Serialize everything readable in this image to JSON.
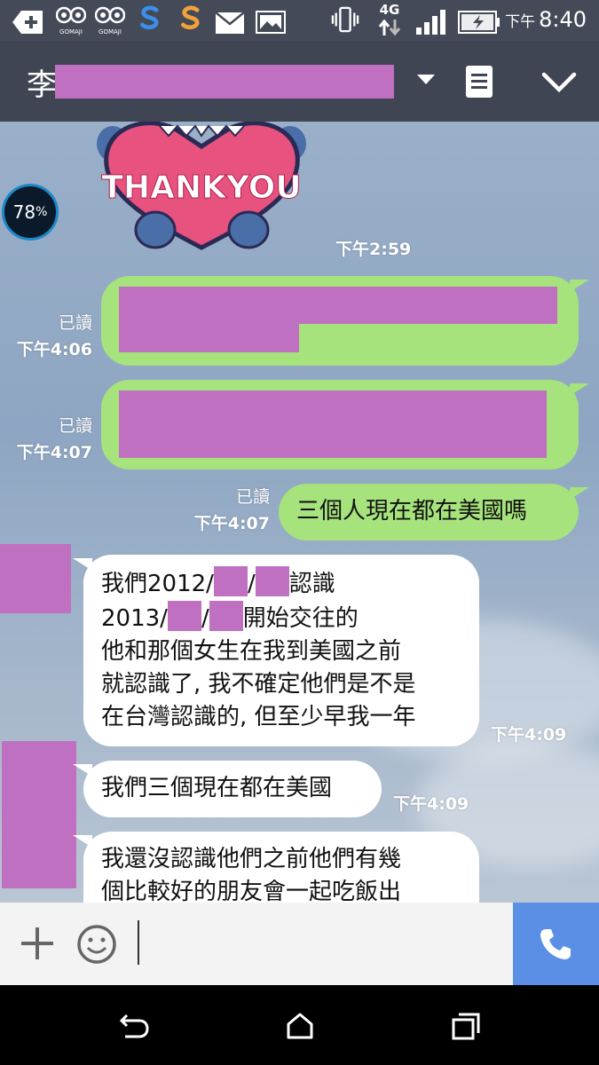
{
  "status_bar": {
    "ampm": "下午",
    "time": "8:40",
    "network": "4G",
    "app_icons": [
      "add-icon",
      "gomaji-icon",
      "gomaji-icon",
      "s-app-icon",
      "s-app-icon",
      "mail-icon",
      "image-icon"
    ],
    "app_labels": [
      "GOMAJI",
      "GOMAJI"
    ]
  },
  "header": {
    "contact_initial": "李"
  },
  "sticker": {
    "text": "THANKYOU",
    "time": "下午2:59"
  },
  "floating_badge": {
    "value": "78",
    "unit": "%"
  },
  "messages": [
    {
      "side": "right",
      "read": "已讀",
      "time": "下午4:06",
      "redacted": true
    },
    {
      "side": "right",
      "read": "已讀",
      "time": "下午4:07",
      "redacted": true
    },
    {
      "side": "right",
      "read": "已讀",
      "time": "下午4:07",
      "text": "三個人現在都在美國嗎"
    },
    {
      "side": "left",
      "time": "下午4:09",
      "lines": [
        "我們2012/",
        "/",
        "認識",
        "2013/",
        "/",
        "開始交往的",
        "他和那個女生在我到美國之前",
        "就認識了, 我不確定他們是不是",
        "在台灣認識的, 但至少早我一年"
      ]
    },
    {
      "side": "left",
      "time": "下午4:09",
      "text": "我們三個現在都在美國"
    },
    {
      "side": "left",
      "lines": [
        "我還沒認識他們之前他們有幾",
        "個比較好的朋友會一起吃飯出"
      ]
    }
  ],
  "input_bar": {
    "plus_icon": "plus-icon",
    "emoji_icon": "smiley-icon",
    "call_icon": "phone-icon"
  },
  "nav_bar": [
    "back-icon",
    "home-icon",
    "recents-icon"
  ],
  "colors": {
    "header": "#3f4553",
    "sent_bubble": "#a6e37c",
    "received_bubble": "#ffffff",
    "redaction": "#c070c0",
    "call_button": "#5b8fe6"
  }
}
